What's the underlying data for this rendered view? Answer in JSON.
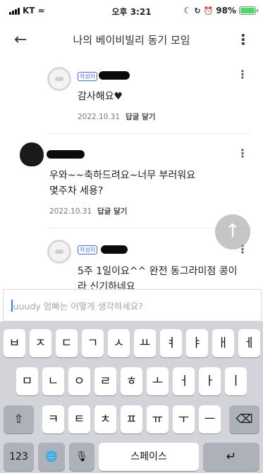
{
  "status_bar": {
    "carrier": "KT",
    "time": "오후 3:21",
    "battery": "98%",
    "icons": [
      "signal-icon",
      "wifi-icon",
      "moon-icon",
      "orientation-lock-icon",
      "alarm-icon",
      "battery-icon"
    ]
  },
  "header": {
    "title": "나의 베이비빌리 동기 모임",
    "back_icon": "arrow-left-icon",
    "more_icon": "more-vertical-icon"
  },
  "comments": [
    {
      "type": "reply",
      "author_tag": "작성자",
      "text": "감사해요♥",
      "date": "2022.10.31",
      "reply_label": "답글 달기"
    },
    {
      "type": "comment",
      "text_line1": "우와~~축하드려요~너무 부러워요",
      "text_line2": "몇주차 세용?",
      "date": "2022.10.31",
      "reply_label": "답글 달기"
    },
    {
      "type": "reply",
      "author_tag": "작성자",
      "text_line1": "5주 1일이요^^ 완전 동그라미점 콩이",
      "text_line2": "라 신기하네요"
    }
  ],
  "scroll_top_icon": "arrow-up-icon",
  "input": {
    "placeholder": "Juuudy 엄빠는 어떻게 생각하세요?"
  },
  "keyboard": {
    "row1": [
      "ㅂ",
      "ㅈ",
      "ㄷ",
      "ㄱ",
      "ㅅ",
      "ㅛ",
      "ㅕ",
      "ㅑ",
      "ㅐ",
      "ㅔ"
    ],
    "row2": [
      "ㅁ",
      "ㄴ",
      "ㅇ",
      "ㄹ",
      "ㅎ",
      "ㅗ",
      "ㅓ",
      "ㅏ",
      "ㅣ"
    ],
    "row3": [
      "ㅋ",
      "ㅌ",
      "ㅊ",
      "ㅍ",
      "ㅠ",
      "ㅜ",
      "ㅡ"
    ],
    "shift_glyph": "⇧",
    "delete_glyph": "⌫",
    "numbers_label": "123",
    "globe_glyph": "🌐",
    "mic_glyph": "🎙",
    "space_label": "스페이스",
    "return_glyph": "↵"
  }
}
